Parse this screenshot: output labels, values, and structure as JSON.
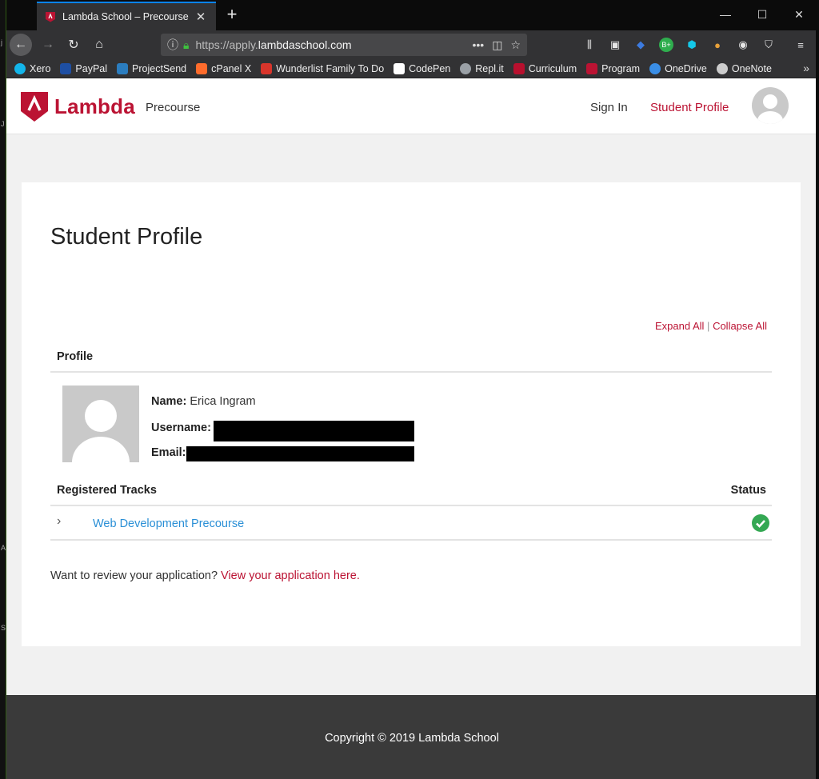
{
  "browser": {
    "tab_title": "Lambda School – Precourse",
    "new_tab": "+",
    "url_scheme": "https://apply.",
    "url_host": "lambdaschool.com",
    "bookmarks": [
      {
        "label": "Xero",
        "color": "#13b5ea"
      },
      {
        "label": "PayPal",
        "color": "#1e4fa3"
      },
      {
        "label": "ProjectSend",
        "color": "#2b7dbf"
      },
      {
        "label": "cPanel X",
        "color": "#ff6c2c"
      },
      {
        "label": "Wunderlist Family To Do",
        "color": "#d9352b"
      },
      {
        "label": "CodePen",
        "color": "#ffffff"
      },
      {
        "label": "Repl.it",
        "color": "#9aa0a6"
      },
      {
        "label": "Curriculum",
        "color": "#b8102e"
      },
      {
        "label": "Program",
        "color": "#bb1333"
      },
      {
        "label": "OneDrive",
        "color": "#3a8ee6"
      },
      {
        "label": "OneNote",
        "color": "#cccccc"
      }
    ]
  },
  "site": {
    "logo_text": "Lambda",
    "section": "Precourse",
    "nav_signin": "Sign In",
    "nav_profile": "Student Profile"
  },
  "profile": {
    "title": "Student Profile",
    "expand_all": "Expand All",
    "separator": "|",
    "collapse_all": "Collapse All",
    "section_profile": "Profile",
    "name_label": "Name:",
    "name_value": "Erica Ingram",
    "username_label": "Username:",
    "email_label": "Email:",
    "tracks_header": "Registered Tracks",
    "status_header": "Status",
    "track_name": "Web Development Precourse",
    "review_text": "Want to review your application?",
    "review_link": "View your application here."
  },
  "footer": {
    "copyright": "Copyright © 2019 Lambda School"
  }
}
